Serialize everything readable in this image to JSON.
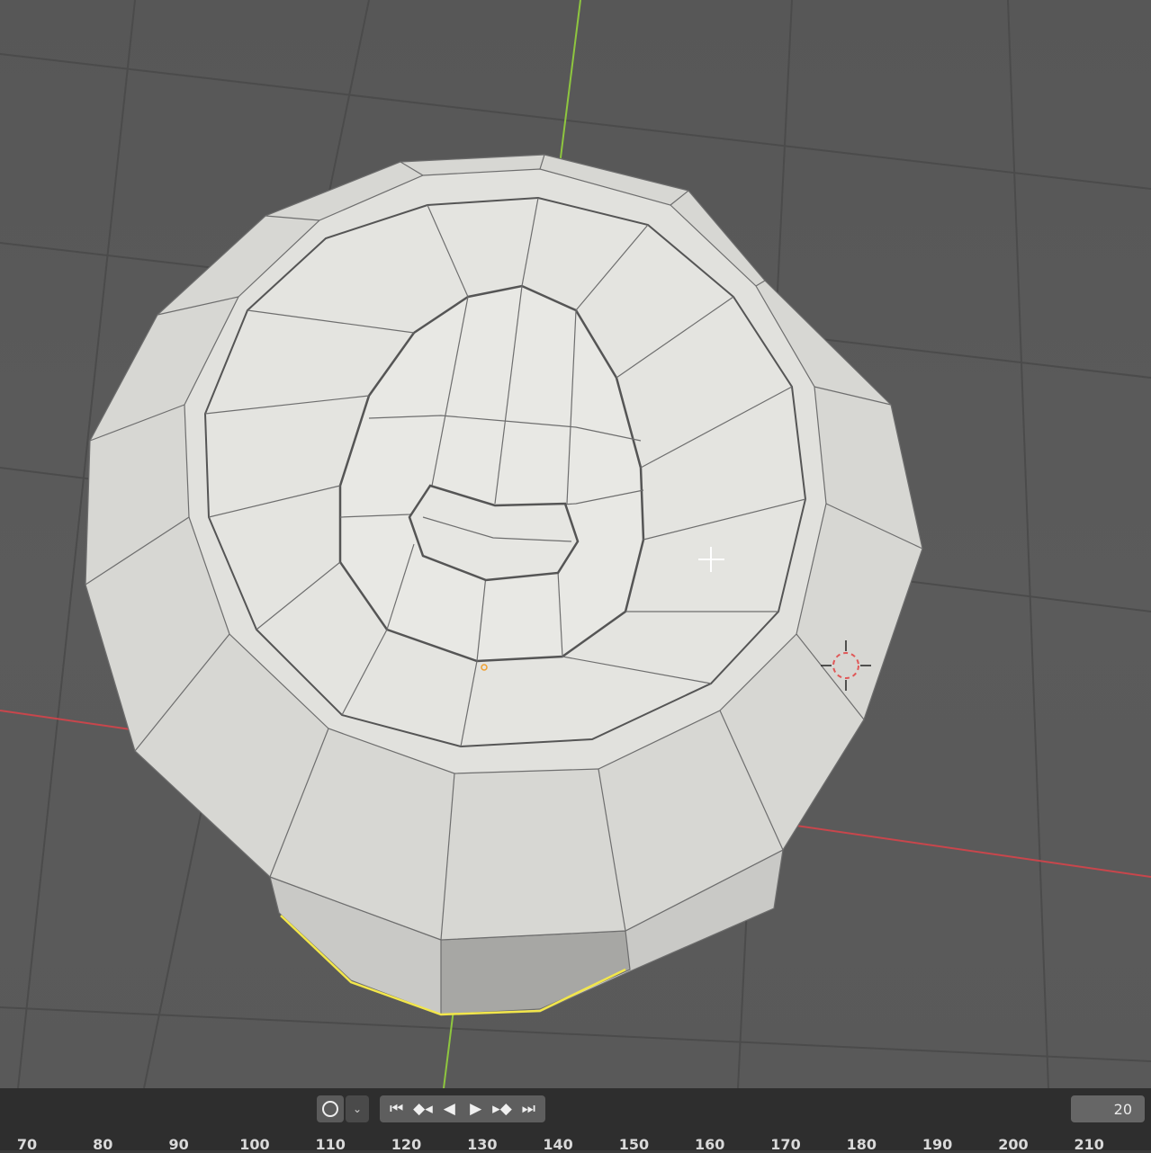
{
  "viewport": {
    "grid_color": "#4a4a4a",
    "x_axis_color": "#c8464c",
    "y_axis_color": "#8ec63f",
    "mesh_fill": "#d9d9d5",
    "mesh_wire": "#6e6e6e",
    "selected_edge_color": "#f2e64b"
  },
  "timeline": {
    "keying_button_icon": "circle-icon",
    "dropdown_icon": "chevron-down-icon",
    "transport_icons": [
      "jump-to-start-icon",
      "jump-to-keyframe-back-icon",
      "play-reverse-icon",
      "play-icon",
      "jump-to-keyframe-forward-icon",
      "jump-to-end-icon"
    ],
    "current_frame": "20",
    "ruler_labels": [
      "70",
      "80",
      "90",
      "100",
      "110",
      "120",
      "130",
      "140",
      "150",
      "160",
      "170",
      "180",
      "190",
      "200",
      "210"
    ]
  }
}
